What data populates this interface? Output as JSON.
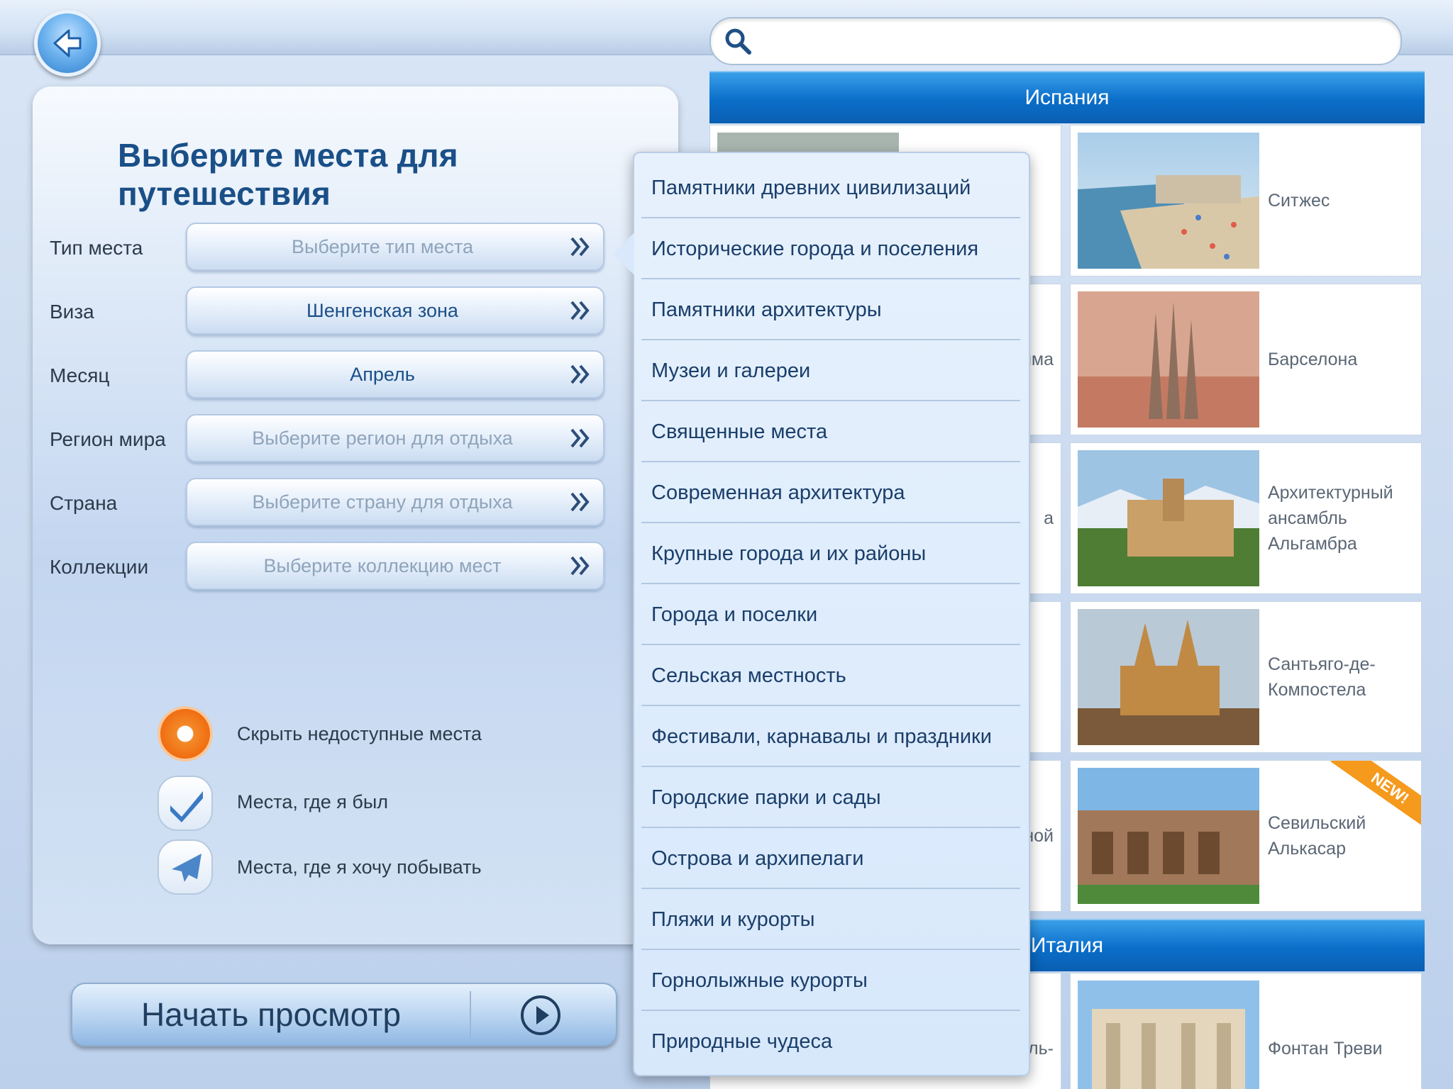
{
  "search": {
    "placeholder": "",
    "value": ""
  },
  "panel": {
    "title": "Выберите места для путешествия",
    "rows": [
      {
        "label": "Тип места",
        "value": "Выберите тип места",
        "set": false
      },
      {
        "label": "Виза",
        "value": "Шенгенская зона",
        "set": true
      },
      {
        "label": "Месяц",
        "value": "Апрель",
        "set": true
      },
      {
        "label": "Регион мира",
        "value": "Выберите регион для отдыха",
        "set": false
      },
      {
        "label": "Страна",
        "value": "Выберите страну для отдыха",
        "set": false
      },
      {
        "label": "Коллекции",
        "value": "Выберите коллекцию мест",
        "set": false
      }
    ],
    "options": [
      {
        "label": "Скрыть недоступные места",
        "icon": "radio-orange-icon"
      },
      {
        "label": "Места, где я был",
        "icon": "checkmark-icon"
      },
      {
        "label": "Места, где я хочу побывать",
        "icon": "airplane-icon"
      }
    ],
    "start_button": "Начать просмотр"
  },
  "dropdown": {
    "items": [
      "Памятники древних цивилизаций",
      "Исторические города и поселения",
      "Памятники архитектуры",
      "Музеи и галереи",
      "Священные места",
      "Современная архитектура",
      "Крупные города и их районы",
      "Города и поселки",
      "Сельская местность",
      "Фестивали, карнавалы и праздники",
      "Городские парки и сады",
      "Острова и архипелаги",
      "Пляжи и курорты",
      "Горнолыжные курорты",
      "Природные чудеса"
    ]
  },
  "list": {
    "sections": [
      {
        "title": "Испания",
        "cards": [
          {
            "name": "Ситжес"
          },
          {
            "name": "Барселона",
            "left_partial": "има"
          },
          {
            "name": "Архитектурный ансамбль Альгамбра",
            "left_partial": "а"
          },
          {
            "name": "Сантьяго-де-Компостела"
          },
          {
            "name": "Севильский Алькасар",
            "left_partial": "ной",
            "badge": "NEW!"
          }
        ]
      },
      {
        "title": "Италия",
        "cards": [
          {
            "name": "Фонтан Треви",
            "left_partial": "ель-"
          }
        ]
      }
    ]
  },
  "colors": {
    "accent_blue": "#0a6ec9",
    "title_blue": "#1a4f87",
    "orange": "#f06a0d"
  }
}
